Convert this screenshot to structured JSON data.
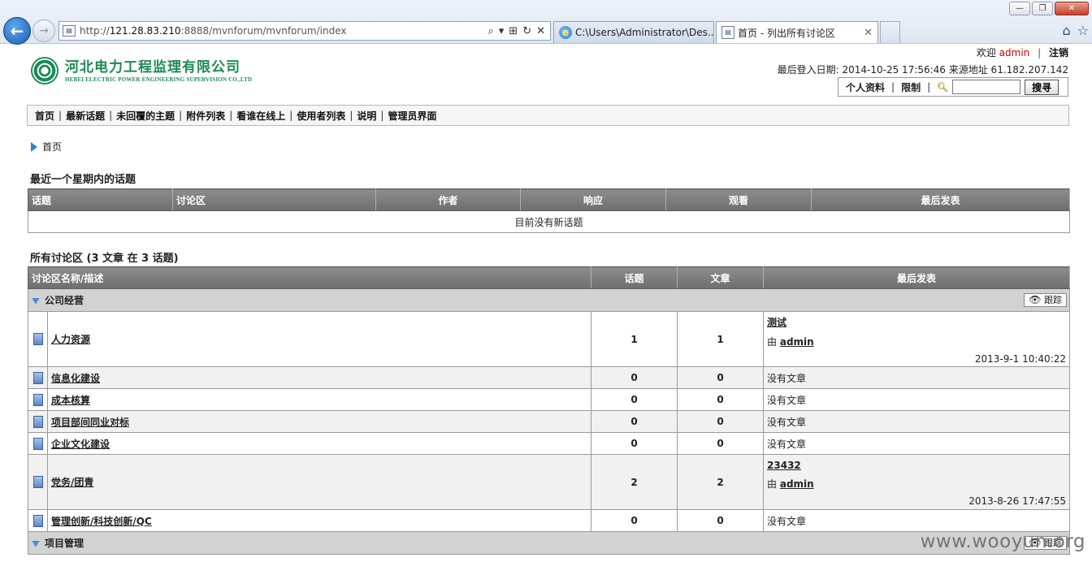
{
  "browser": {
    "url_prefix": "http://",
    "url_host": "121.28.83.210",
    "url_path": ":8888/mvnforum/mvnforum/index",
    "tabs": [
      {
        "title": "C:\\Users\\Administrator\\Des..."
      },
      {
        "title": "首页 - 列出所有讨论区"
      }
    ]
  },
  "header": {
    "logo_cn": "河北电力工程监理有限公司",
    "logo_en": "HEBEI ELECTRIC POWER ENGINEERING SUPERVISION CO.,LTD",
    "welcome_label": "欢迎",
    "username": "admin",
    "logout": "注销",
    "last_login": "最后登入日期: 2014-10-25 17:56:46 来源地址 61.182.207.142",
    "profile": "个人资料",
    "restrict": "限制",
    "search_button": "搜寻",
    "search_value": ""
  },
  "menu": [
    "首页",
    "最新话题",
    "未回覆的主题",
    "附件列表",
    "看谁在线上",
    "使用者列表",
    "说明",
    "管理员界面"
  ],
  "breadcrumb": "首页",
  "recent": {
    "title": "最近一个星期内的话题",
    "columns": [
      "话题",
      "讨论区",
      "作者",
      "响应",
      "观看",
      "最后发表"
    ],
    "empty": "目前没有新话题"
  },
  "forums": {
    "title": "所有讨论区 (3 文章 在 3 话题)",
    "columns": [
      "讨论区名称/描述",
      "话题",
      "文章",
      "最后发表"
    ],
    "track_label": "跟踪",
    "by_label": "由",
    "categories": [
      {
        "name": "公司经营",
        "items": [
          {
            "name": "人力资源",
            "topics": "1",
            "posts": "1",
            "last_title": "测试",
            "last_by": "admin",
            "last_time": "2013-9-1 10:40:22"
          },
          {
            "name": "信息化建设",
            "topics": "0",
            "posts": "0",
            "last_text": "没有文章"
          },
          {
            "name": "成本核算",
            "topics": "0",
            "posts": "0",
            "last_text": "没有文章"
          },
          {
            "name": "项目部间同业对标",
            "topics": "0",
            "posts": "0",
            "last_text": "没有文章"
          },
          {
            "name": "企业文化建设",
            "topics": "0",
            "posts": "0",
            "last_text": "没有文章"
          },
          {
            "name": "党务/团青",
            "topics": "2",
            "posts": "2",
            "last_title": "23432",
            "last_by": "admin",
            "last_time": "2013-8-26 17:47:55"
          },
          {
            "name": "管理创新/科技创新/QC",
            "topics": "0",
            "posts": "0",
            "last_text": "没有文章"
          }
        ]
      },
      {
        "name": "项目管理",
        "items": []
      }
    ]
  },
  "watermark": "www.wooyun.org"
}
